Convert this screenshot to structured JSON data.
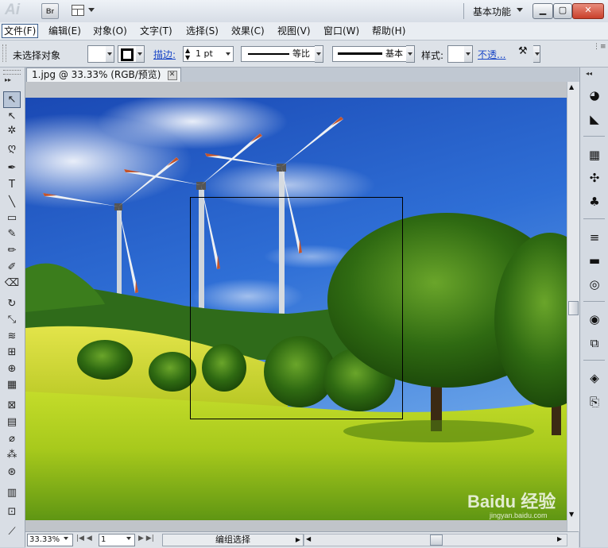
{
  "app": {
    "logo": "Ai",
    "bridge_label": "Br",
    "workspace": "基本功能",
    "window_buttons": [
      "▁",
      "▢",
      "✕"
    ]
  },
  "menu": [
    {
      "label": "文件(F)"
    },
    {
      "label": "编辑(E)"
    },
    {
      "label": "对象(O)"
    },
    {
      "label": "文字(T)"
    },
    {
      "label": "选择(S)"
    },
    {
      "label": "效果(C)"
    },
    {
      "label": "视图(V)"
    },
    {
      "label": "窗口(W)"
    },
    {
      "label": "帮助(H)"
    }
  ],
  "control": {
    "selection_status": "未选择对象",
    "stroke_label": "描边:",
    "stroke_weight": "1 pt",
    "profile_1": "等比",
    "profile_2": "基本",
    "style_label": "样式:",
    "opacity_label": "不透..."
  },
  "document": {
    "tab_title": "1.jpg @ 33.33% (RGB/预览)",
    "tab_close": "✕"
  },
  "statusbar": {
    "zoom": "33.33%",
    "artboard_number": "1",
    "tool_status": "编组选择"
  },
  "watermark": {
    "brand": "Baidu 经验",
    "url": "jingyan.baidu.com"
  },
  "colors": {
    "sky_top": "#1f4fb8",
    "grass": "#c6dc22",
    "selection_rect": "#000000"
  },
  "tools": [
    {
      "name": "selection-tool-icon",
      "glyph": "↖"
    },
    {
      "name": "direct-selection-tool-icon",
      "glyph": "↖"
    },
    {
      "name": "magic-wand-tool-icon",
      "glyph": "✲"
    },
    {
      "name": "lasso-tool-icon",
      "glyph": "ღ"
    },
    {
      "name": "pen-tool-icon",
      "glyph": "✒"
    },
    {
      "name": "type-tool-icon",
      "glyph": "T"
    },
    {
      "name": "line-tool-icon",
      "glyph": "╲"
    },
    {
      "name": "rectangle-tool-icon",
      "glyph": "▭"
    },
    {
      "name": "paintbrush-tool-icon",
      "glyph": "✎"
    },
    {
      "name": "pencil-tool-icon",
      "glyph": "✏"
    },
    {
      "name": "blob-brush-tool-icon",
      "glyph": "✐"
    },
    {
      "name": "eraser-tool-icon",
      "glyph": "⌫"
    },
    {
      "name": "rotate-tool-icon",
      "glyph": "↻"
    },
    {
      "name": "scale-tool-icon",
      "glyph": "⤡"
    },
    {
      "name": "warp-tool-icon",
      "glyph": "≋"
    },
    {
      "name": "free-transform-tool-icon",
      "glyph": "⊞"
    },
    {
      "name": "shape-builder-tool-icon",
      "glyph": "⊕"
    },
    {
      "name": "perspective-grid-tool-icon",
      "glyph": "▦"
    },
    {
      "name": "mesh-tool-icon",
      "glyph": "⊠"
    },
    {
      "name": "gradient-tool-icon",
      "glyph": "▤"
    },
    {
      "name": "eyedropper-tool-icon",
      "glyph": "⌀"
    },
    {
      "name": "blend-tool-icon",
      "glyph": "⁂"
    },
    {
      "name": "symbol-sprayer-tool-icon",
      "glyph": "⊛"
    },
    {
      "name": "column-graph-tool-icon",
      "glyph": "▥"
    },
    {
      "name": "artboard-tool-icon",
      "glyph": "⊡"
    },
    {
      "name": "slice-tool-icon",
      "glyph": "⟋"
    }
  ],
  "panels": [
    {
      "name": "color-panel-icon",
      "glyph": "◕"
    },
    {
      "name": "color-guide-panel-icon",
      "glyph": "◣"
    },
    {
      "name": "swatches-panel-icon",
      "glyph": "▦"
    },
    {
      "name": "brushes-panel-icon",
      "glyph": "✣"
    },
    {
      "name": "symbols-panel-icon",
      "glyph": "♣"
    },
    {
      "name": "stroke-panel-icon",
      "glyph": "≡"
    },
    {
      "name": "gradient-panel-icon",
      "glyph": "▬"
    },
    {
      "name": "transparency-panel-icon",
      "glyph": "◎"
    },
    {
      "name": "appearance-panel-icon",
      "glyph": "◉"
    },
    {
      "name": "graphic-styles-panel-icon",
      "glyph": "⧉"
    },
    {
      "name": "layers-panel-icon",
      "glyph": "◈"
    },
    {
      "name": "artboards-panel-icon",
      "glyph": "⎘"
    }
  ]
}
